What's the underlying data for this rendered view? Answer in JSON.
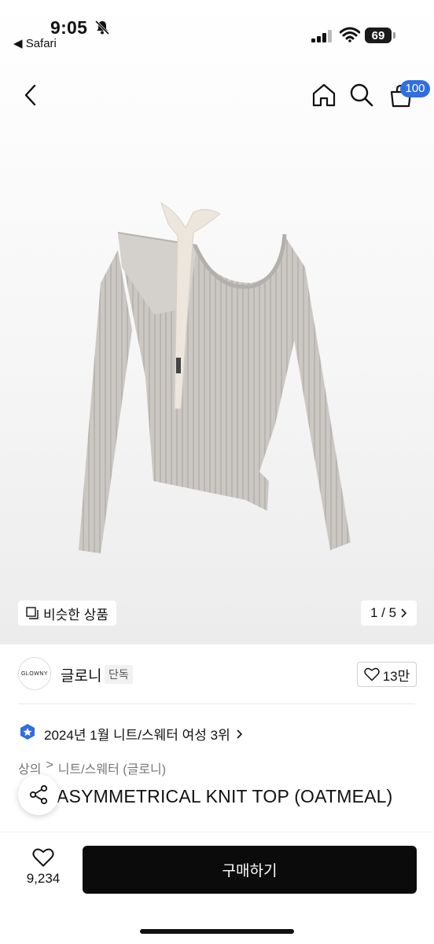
{
  "status_bar": {
    "time": "9:05",
    "back_app": "◀ Safari",
    "battery": "69",
    "icons": [
      "bell-muted-icon",
      "signal-icon",
      "wifi-icon",
      "battery-icon"
    ]
  },
  "nav": {
    "icons": [
      "back-chevron-icon",
      "home-icon",
      "search-icon",
      "cart-icon"
    ],
    "cart_count": "100"
  },
  "gallery": {
    "similar_label": "비슷한 상품",
    "page_indicator": "1 / 5",
    "image": "ribbed-knit-asymmetrical-top"
  },
  "brand": {
    "logo_text": "GLOWNY",
    "name": "글로니",
    "tag": "단독",
    "likes": "13만"
  },
  "ranking": {
    "text": "2024년 1월 니트/스웨터 여성 3위"
  },
  "breadcrumb": [
    "상의",
    ">",
    "니트/스웨터 (글로니)"
  ],
  "product": {
    "title": "ASYMMETRICAL KNIT TOP (OATMEAL)"
  },
  "bottom": {
    "wish_count": "9,234",
    "buy_label": "구매하기"
  },
  "colors": {
    "accent_badge": "#2f6fe0",
    "buy_button": "#0b0b0b",
    "knit": "#c9c6c2"
  }
}
